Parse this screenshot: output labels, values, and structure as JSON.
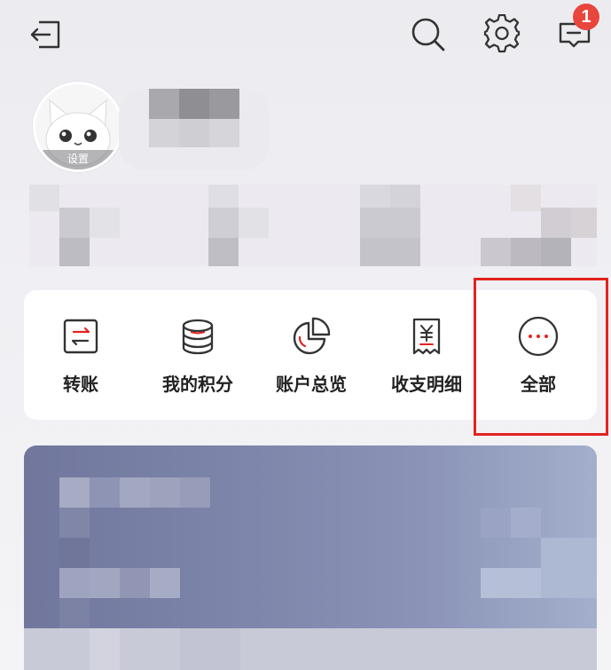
{
  "header": {
    "back_icon": "exit-icon",
    "search_icon": "search-icon",
    "settings_icon": "gear-icon",
    "messages_icon": "message-icon",
    "message_badge": "1"
  },
  "profile": {
    "avatar_label": "设置"
  },
  "quick_actions": [
    {
      "label": "转账",
      "icon": "transfer-icon"
    },
    {
      "label": "我的积分",
      "icon": "coins-icon"
    },
    {
      "label": "账户总览",
      "icon": "pie-chart-icon"
    },
    {
      "label": "收支明细",
      "icon": "receipt-icon"
    },
    {
      "label": "全部",
      "icon": "more-icon"
    }
  ],
  "colors": {
    "accent_red": "#e3231f",
    "badge_red": "#e8453c",
    "icon_dark": "#333333"
  }
}
